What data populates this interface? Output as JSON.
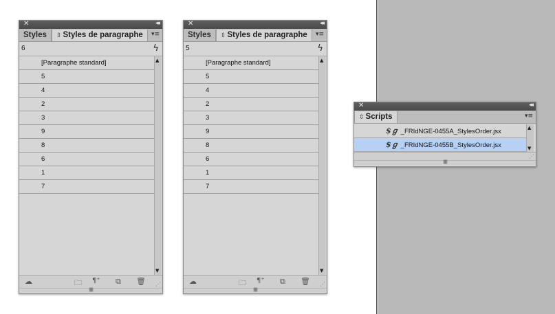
{
  "panels": [
    {
      "tab_inactive": "Styles",
      "tab_active": "Styles de paragraphe",
      "info_value": "6",
      "items": [
        "[Paragraphe standard]",
        "5",
        "4",
        "2",
        "3",
        "9",
        "8",
        "6",
        "1",
        "7"
      ]
    },
    {
      "tab_inactive": "Styles",
      "tab_active": "Styles de paragraphe",
      "info_value": "5",
      "items": [
        "[Paragraphe standard]",
        "5",
        "4",
        "2",
        "3",
        "9",
        "8",
        "6",
        "1",
        "7"
      ]
    }
  ],
  "scripts_panel": {
    "tab_label": "Scripts",
    "items": [
      {
        "label": "_FRIdNGE-0455A_StylesOrder.jsx",
        "selected": false
      },
      {
        "label": "_FRIdNGE-0455B_StylesOrder.jsx",
        "selected": true
      }
    ]
  },
  "icons": {
    "close": "close-icon",
    "collapse": "collapse-icon",
    "menu": "panel-menu-icon",
    "bolt": "quick-apply-icon",
    "cloud": "cloud-icon",
    "folder": "new-group-icon",
    "clear": "clear-overrides-icon",
    "new": "new-style-icon",
    "trash": "trash-icon",
    "script": "script-icon"
  },
  "colors": {
    "selected_row": "#b7d0f3",
    "panel_bg": "#d6d6d6",
    "desktop_gray": "#b9b9b9"
  }
}
